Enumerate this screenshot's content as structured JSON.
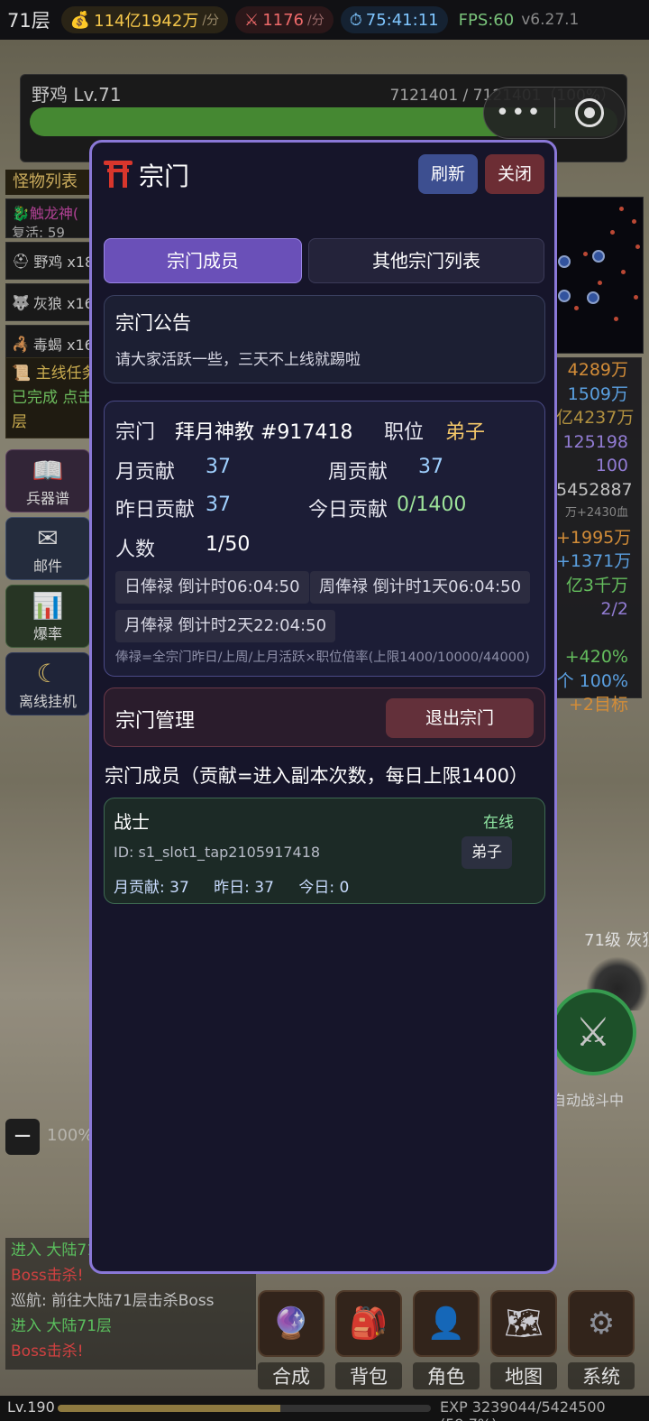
{
  "topbar": {
    "floor": "71层",
    "gold": "114亿1942万",
    "gold_unit": "/分",
    "kills": "1176",
    "kills_unit": "/分",
    "timer": "75:41:11",
    "fps": "FPS:60",
    "version": "v6.27.1"
  },
  "boss": {
    "name": "野鸡 Lv.71",
    "hp_text": "7121401 / 7121401（100%）",
    "hp_fraction": 1.0
  },
  "capsule": {
    "more_icon": "more-dots-icon",
    "target_icon": "target-icon"
  },
  "sidebar": {
    "title": "怪物列表",
    "monsters": [
      {
        "name": "触龙神(",
        "sub": "复活: 59"
      },
      {
        "name": "野鸡 x18"
      },
      {
        "name": "灰狼 x16"
      },
      {
        "name": "毒蝎 x16"
      }
    ],
    "quest": {
      "title": "主线任务",
      "line2": "已完成 点击",
      "line3": "层"
    },
    "buttons": [
      {
        "label": "兵器谱",
        "icon": "book-icon"
      },
      {
        "label": "邮件",
        "icon": "mail-icon"
      },
      {
        "label": "爆率",
        "icon": "chart-icon"
      },
      {
        "label": "离线挂机",
        "icon": "moon-icon"
      }
    ]
  },
  "right_stats": [
    "4289万",
    "1509万",
    "亿4237万",
    "125198",
    "100",
    "5452887",
    "万+2430血",
    "+1995万",
    "+1371万",
    "亿3千万",
    "2/2",
    "",
    "+420%",
    "个 100%",
    "+2目标"
  ],
  "field": {
    "enemy_label": "71级 灰狼",
    "auto_fight": "自动战斗中",
    "zoom": "100%"
  },
  "log": [
    {
      "text": "进入 大陆71",
      "color": "green"
    },
    {
      "text": "Boss击杀!",
      "color": "red"
    },
    {
      "text": "巡航: 前往大陆71层击杀Boss",
      "color": "white"
    },
    {
      "text": "进入 大陆71层",
      "color": "green"
    },
    {
      "text": "Boss击杀!",
      "color": "red"
    }
  ],
  "dock": [
    {
      "label": "合成",
      "icon": "crystal-ball-icon"
    },
    {
      "label": "背包",
      "icon": "backpack-icon"
    },
    {
      "label": "角色",
      "icon": "character-icon"
    },
    {
      "label": "地图",
      "icon": "map-icon"
    },
    {
      "label": "系统",
      "icon": "gear-icon"
    }
  ],
  "exp": {
    "level": "Lv.190",
    "text": "EXP 3239044/5424500 (59.7%)",
    "fraction": 0.597
  },
  "modal": {
    "title": "宗门",
    "refresh": "刷新",
    "close": "关闭",
    "tabs": [
      "宗门成员",
      "其他宗门列表"
    ],
    "notice": {
      "heading": "宗门公告",
      "text": "请大家活跃一些，三天不上线就踢啦"
    },
    "info": {
      "sect_label": "宗门",
      "sect_name": "拜月神教 #917418",
      "position_label": "职位",
      "position": "弟子",
      "monthly_label": "月贡献",
      "monthly": "37",
      "weekly_label": "周贡献",
      "weekly": "37",
      "yesterday_label": "昨日贡献",
      "yesterday": "37",
      "today_label": "今日贡献",
      "today": "0/1400",
      "count_label": "人数",
      "count": "1/50",
      "daily_salary": "日俸禄 倒计时06:04:50",
      "weekly_salary": "周俸禄 倒计时1天06:04:50",
      "monthly_salary": "月俸禄 倒计时2天22:04:50",
      "formula": "俸禄=全宗门昨日/上周/上月活跃×职位倍率(上限1400/10000/44000)"
    },
    "manage": {
      "heading": "宗门管理",
      "quit": "退出宗门"
    },
    "members_title": "宗门成员（贡献=进入副本次数，每日上限1400）",
    "members": [
      {
        "name": "战士",
        "status": "在线",
        "id": "ID: s1_slot1_tap2105917418",
        "rank": "弟子",
        "monthly": "月贡献: 37",
        "yesterday": "昨日: 37",
        "today": "今日: 0"
      }
    ]
  }
}
